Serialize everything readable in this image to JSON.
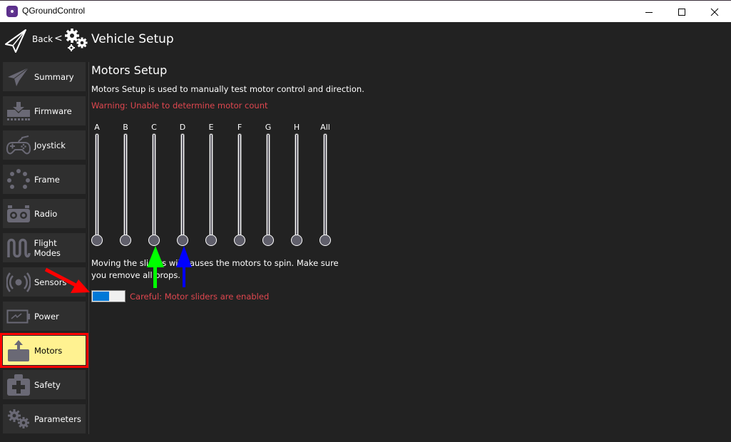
{
  "window": {
    "title": "QGroundControl",
    "controls": [
      "minimize",
      "maximize",
      "close"
    ]
  },
  "toolbar": {
    "back_label": "Back",
    "back_chevron": "<",
    "title": "Vehicle Setup",
    "icons": [
      "paper-plane-icon",
      "gears-icon"
    ]
  },
  "sidebar": {
    "items": [
      {
        "label": "Summary",
        "icon": "paper-plane-icon",
        "active": false
      },
      {
        "label": "Firmware",
        "icon": "download-icon",
        "active": false
      },
      {
        "label": "Joystick",
        "icon": "gamepad-icon",
        "active": false
      },
      {
        "label": "Frame",
        "icon": "frame-dots-icon",
        "active": false
      },
      {
        "label": "Radio",
        "icon": "radio-icon",
        "active": false
      },
      {
        "label": "Flight Modes",
        "icon": "wave-icon",
        "active": false
      },
      {
        "label": "Sensors",
        "icon": "sensors-icon",
        "active": false
      },
      {
        "label": "Power",
        "icon": "battery-icon",
        "active": false
      },
      {
        "label": "Motors",
        "icon": "motor-icon",
        "active": true
      },
      {
        "label": "Safety",
        "icon": "medkit-icon",
        "active": false
      },
      {
        "label": "Parameters",
        "icon": "gears-icon",
        "active": false
      }
    ]
  },
  "main": {
    "heading": "Motors Setup",
    "description": "Motors Setup is used to manually test motor control and direction.",
    "warning": "Warning: Unable to determine motor count",
    "sliders": [
      {
        "label": "A",
        "value": 0
      },
      {
        "label": "B",
        "value": 0
      },
      {
        "label": "C",
        "value": 0
      },
      {
        "label": "D",
        "value": 0
      },
      {
        "label": "E",
        "value": 0
      },
      {
        "label": "F",
        "value": 0
      },
      {
        "label": "G",
        "value": 0
      },
      {
        "label": "H",
        "value": 0
      },
      {
        "label": "All",
        "value": 0
      }
    ],
    "note": "Moving the sliders will causes the motors to spin. Make sure you remove all props.",
    "switch": {
      "enabled": true
    },
    "careful": "Careful: Motor sliders are enabled"
  },
  "annotations": {
    "colors": {
      "red": "#ff0000",
      "green": "#00ff00",
      "blue": "#0000ff",
      "highlight": "#fff291",
      "warning": "#e0474f",
      "switch_on": "#0078d7"
    }
  }
}
